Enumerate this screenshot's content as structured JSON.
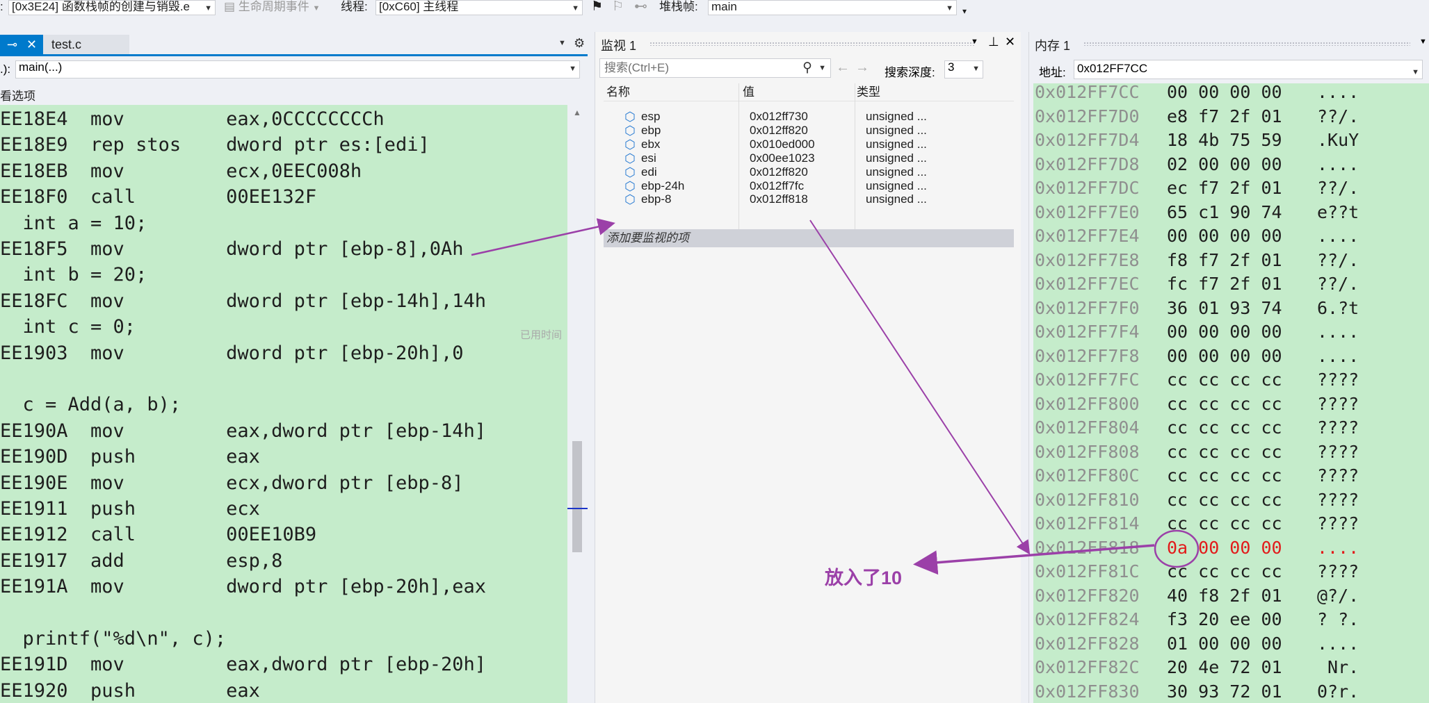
{
  "toolbar": {
    "frame_combo": "[0x3E24] 函数栈帧的创建与销毁.e",
    "lifecycle_label": "生命周期事件",
    "thread_label": "线程:",
    "thread_combo": "[0xC60] 主线程",
    "stackframe_label": "堆栈帧:",
    "stackframe_combo": "main"
  },
  "left_panel": {
    "file_tab": "test.c",
    "function_combo": "main(...)",
    "function_prefix": ".):",
    "view_options": "看选项",
    "elapsed_hint": "已用时间",
    "code_lines": [
      "EE18E4  mov         eax,0CCCCCCCCh",
      "EE18E9  rep stos    dword ptr es:[edi]",
      "EE18EB  mov         ecx,0EEC008h",
      "EE18F0  call        00EE132F",
      "  int a = 10;",
      "EE18F5  mov         dword ptr [ebp-8],0Ah",
      "  int b = 20;",
      "EE18FC  mov         dword ptr [ebp-14h],14h",
      "  int c = 0;",
      "EE1903  mov         dword ptr [ebp-20h],0",
      "",
      "  c = Add(a, b);",
      "EE190A  mov         eax,dword ptr [ebp-14h]",
      "EE190D  push        eax",
      "EE190E  mov         ecx,dword ptr [ebp-8]",
      "EE1911  push        ecx",
      "EE1912  call        00EE10B9",
      "EE1917  add         esp,8",
      "EE191A  mov         dword ptr [ebp-20h],eax",
      "",
      "  printf(\"%d\\n\", c);",
      "EE191D  mov         eax,dword ptr [ebp-20h]",
      "EE1920  push        eax"
    ]
  },
  "watch": {
    "title": "监视 1",
    "search_placeholder": "搜索(Ctrl+E)",
    "depth_label": "搜索深度:",
    "depth_value": "3",
    "headers": {
      "name": "名称",
      "value": "值",
      "type": "类型"
    },
    "rows": [
      {
        "name": "esp",
        "value": "0x012ff730",
        "type": "unsigned ..."
      },
      {
        "name": "ebp",
        "value": "0x012ff820",
        "type": "unsigned ..."
      },
      {
        "name": "ebx",
        "value": "0x010ed000",
        "type": "unsigned ..."
      },
      {
        "name": "esi",
        "value": "0x00ee1023",
        "type": "unsigned ..."
      },
      {
        "name": "edi",
        "value": "0x012ff820",
        "type": "unsigned ..."
      },
      {
        "name": "ebp-24h",
        "value": "0x012ff7fc",
        "type": "unsigned ..."
      },
      {
        "name": "ebp-8",
        "value": "0x012ff818",
        "type": "unsigned ..."
      }
    ],
    "add_item": "添加要监视的项"
  },
  "memory": {
    "title": "内存 1",
    "address_label": "地址:",
    "address_value": "0x012FF7CC",
    "rows": [
      {
        "addr": "0x012FF7CC",
        "bytes": "00 00 00 00",
        "ascii": "....",
        "changed": false
      },
      {
        "addr": "0x012FF7D0",
        "bytes": "e8 f7 2f 01",
        "ascii": "??/.",
        "changed": false
      },
      {
        "addr": "0x012FF7D4",
        "bytes": "18 4b 75 59",
        "ascii": ".KuY",
        "changed": false
      },
      {
        "addr": "0x012FF7D8",
        "bytes": "02 00 00 00",
        "ascii": "....",
        "changed": false
      },
      {
        "addr": "0x012FF7DC",
        "bytes": "ec f7 2f 01",
        "ascii": "??/.",
        "changed": false
      },
      {
        "addr": "0x012FF7E0",
        "bytes": "65 c1 90 74",
        "ascii": "e??t",
        "changed": false
      },
      {
        "addr": "0x012FF7E4",
        "bytes": "00 00 00 00",
        "ascii": "....",
        "changed": false
      },
      {
        "addr": "0x012FF7E8",
        "bytes": "f8 f7 2f 01",
        "ascii": "??/.",
        "changed": false
      },
      {
        "addr": "0x012FF7EC",
        "bytes": "fc f7 2f 01",
        "ascii": "??/.",
        "changed": false
      },
      {
        "addr": "0x012FF7F0",
        "bytes": "36 01 93 74",
        "ascii": "6.?t",
        "changed": false
      },
      {
        "addr": "0x012FF7F4",
        "bytes": "00 00 00 00",
        "ascii": "....",
        "changed": false
      },
      {
        "addr": "0x012FF7F8",
        "bytes": "00 00 00 00",
        "ascii": "....",
        "changed": false
      },
      {
        "addr": "0x012FF7FC",
        "bytes": "cc cc cc cc",
        "ascii": "????",
        "changed": false
      },
      {
        "addr": "0x012FF800",
        "bytes": "cc cc cc cc",
        "ascii": "????",
        "changed": false
      },
      {
        "addr": "0x012FF804",
        "bytes": "cc cc cc cc",
        "ascii": "????",
        "changed": false
      },
      {
        "addr": "0x012FF808",
        "bytes": "cc cc cc cc",
        "ascii": "????",
        "changed": false
      },
      {
        "addr": "0x012FF80C",
        "bytes": "cc cc cc cc",
        "ascii": "????",
        "changed": false
      },
      {
        "addr": "0x012FF810",
        "bytes": "cc cc cc cc",
        "ascii": "????",
        "changed": false
      },
      {
        "addr": "0x012FF814",
        "bytes": "cc cc cc cc",
        "ascii": "????",
        "changed": false
      },
      {
        "addr": "0x012FF818",
        "bytes": "0a 00 00 00",
        "ascii": "....",
        "changed": true
      },
      {
        "addr": "0x012FF81C",
        "bytes": "cc cc cc cc",
        "ascii": "????",
        "changed": false
      },
      {
        "addr": "0x012FF820",
        "bytes": "40 f8 2f 01",
        "ascii": "@?/.",
        "changed": false
      },
      {
        "addr": "0x012FF824",
        "bytes": "f3 20 ee 00",
        "ascii": "? ?.",
        "changed": false
      },
      {
        "addr": "0x012FF828",
        "bytes": "01 00 00 00",
        "ascii": "....",
        "changed": false
      },
      {
        "addr": "0x012FF82C",
        "bytes": "20 4e 72 01",
        "ascii": " Nr.",
        "changed": false
      },
      {
        "addr": "0x012FF830",
        "bytes": "30 93 72 01",
        "ascii": "0?r.",
        "changed": false
      }
    ]
  },
  "annotation": {
    "callout": "放入了10",
    "color": "#9b40a8"
  },
  "icons": [
    "pin-icon",
    "close-icon",
    "gear-icon",
    "search-icon",
    "back-arrow-icon",
    "forward-arrow-icon",
    "watch-variable-icon",
    "flag-icon",
    "dropdown-icon"
  ]
}
